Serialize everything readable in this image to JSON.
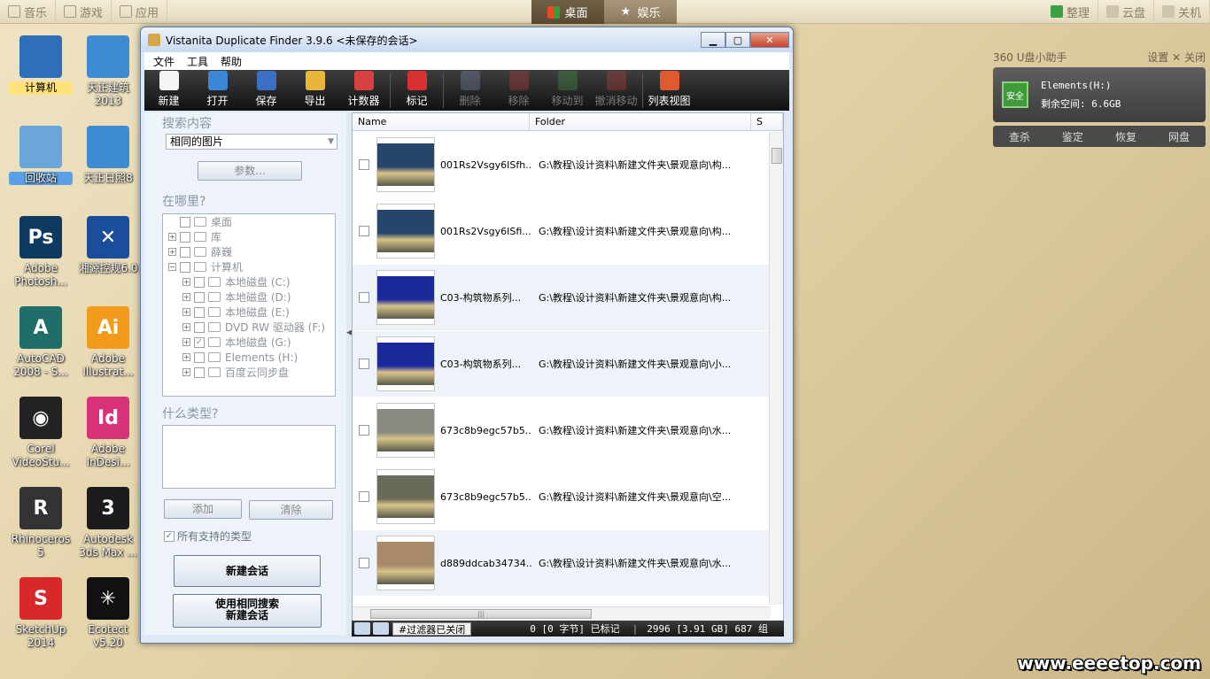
{
  "topbar": {
    "left_items": [
      {
        "icon": "music-note-icon",
        "label": "音乐"
      },
      {
        "icon": "gamepad-icon",
        "label": "游戏"
      },
      {
        "icon": "cube-icon",
        "label": "应用"
      }
    ],
    "center_tabs": [
      {
        "icon": "windows-logo-icon",
        "label": "桌面",
        "active": true
      },
      {
        "icon": "star-icon",
        "label": "娱乐",
        "active": false
      }
    ],
    "right_items": [
      {
        "icon": "organize-icon",
        "label": "整理"
      },
      {
        "icon": "cloud-icon",
        "label": "云盘"
      },
      {
        "icon": "power-icon",
        "label": "关机"
      }
    ]
  },
  "desktop": {
    "icons": [
      {
        "label": "计算机",
        "color": "#2f6fb8"
      },
      {
        "label": "天正建筑\n2013",
        "color": "#3f8bd1"
      },
      {
        "label": "回收站",
        "color": "#6aa6d8"
      },
      {
        "label": "天正日照8",
        "color": "#3f8bd1"
      },
      {
        "label": "Adobe\nPhotosh...",
        "color": "#0d3a5e",
        "glyph": "Ps"
      },
      {
        "label": "湘源控规6.0",
        "color": "#1a4e9a",
        "glyph": "✕"
      },
      {
        "label": "AutoCAD\n2008 - S...",
        "color": "#1f6e6a",
        "glyph": "A"
      },
      {
        "label": "Adobe\nIllustrat...",
        "color": "#f29a1a",
        "glyph": "Ai"
      },
      {
        "label": "Corel\nVideoStu...",
        "color": "#222222",
        "glyph": "◉"
      },
      {
        "label": "Adobe\nInDesi...",
        "color": "#d8327a",
        "glyph": "Id"
      },
      {
        "label": "Rhinoceros\n5",
        "color": "#333333",
        "glyph": "R"
      },
      {
        "label": "Autodesk\n3ds Max ...",
        "color": "#1c1c1c",
        "glyph": "3"
      },
      {
        "label": "SketchUp\n2014",
        "color": "#d8282a",
        "glyph": "S"
      },
      {
        "label": "Ecotect\nv5.20",
        "color": "#111111",
        "glyph": "✳"
      }
    ]
  },
  "uhelper": {
    "title": "360 U盘小助手",
    "settings_label": "设置",
    "close_label": "关闭",
    "badge": "安全",
    "drive_name": "Elements(H:)",
    "free_space": "剩余空间: 6.6GB",
    "buttons": [
      "查杀",
      "鉴定",
      "恢复",
      "网盘"
    ]
  },
  "watermark": "www.eeeetop.com",
  "window": {
    "title": "Vistanita Duplicate Finder 3.9.6 <未保存的会话>",
    "menu": [
      "文件",
      "工具",
      "帮助"
    ],
    "toolbar": [
      {
        "label": "新建",
        "icon": "new-icon",
        "color": "#f4f4f4",
        "disabled": false
      },
      {
        "label": "打开",
        "icon": "open-folder-icon",
        "color": "#3c86d8",
        "disabled": false
      },
      {
        "label": "保存",
        "icon": "save-icon",
        "color": "#3b6fc4",
        "disabled": false
      },
      {
        "label": "导出",
        "icon": "export-icon",
        "color": "#e7b63a",
        "disabled": false
      },
      {
        "label": "计数器",
        "icon": "counter-icon",
        "color": "#d94040",
        "disabled": false
      },
      {
        "label": "标记",
        "icon": "check-mark-icon",
        "color": "#d93030",
        "disabled": false
      },
      {
        "label": "删除",
        "icon": "delete-icon",
        "color": "#7a8fb0",
        "disabled": true
      },
      {
        "label": "移除",
        "icon": "remove-icon",
        "color": "#c04040",
        "disabled": true
      },
      {
        "label": "移动到",
        "icon": "move-to-icon",
        "color": "#4a9a4a",
        "disabled": true
      },
      {
        "label": "撤消移动",
        "icon": "undo-move-icon",
        "color": "#c04040",
        "disabled": true
      },
      {
        "label": "列表视图",
        "icon": "list-view-icon",
        "color": "#e05a30",
        "disabled": false
      }
    ],
    "left": {
      "search_title": "搜索内容",
      "search_value": "相同的图片",
      "params_button": "参数...",
      "where_title": "在哪里?",
      "tree": [
        {
          "label": "桌面",
          "indent": 0,
          "expander": "",
          "checked": false
        },
        {
          "label": "库",
          "indent": 0,
          "expander": "+",
          "checked": false
        },
        {
          "label": "薛巍",
          "indent": 0,
          "expander": "+",
          "checked": false
        },
        {
          "label": "计算机",
          "indent": 0,
          "expander": "-",
          "checked": false
        },
        {
          "label": "本地磁盘 (C:)",
          "indent": 1,
          "expander": "+",
          "checked": false
        },
        {
          "label": "本地磁盘 (D:)",
          "indent": 1,
          "expander": "+",
          "checked": false
        },
        {
          "label": "本地磁盘 (E:)",
          "indent": 1,
          "expander": "+",
          "checked": false
        },
        {
          "label": "DVD RW 驱动器 (F:)",
          "indent": 1,
          "expander": "+",
          "checked": false
        },
        {
          "label": "本地磁盘 (G:)",
          "indent": 1,
          "expander": "+",
          "checked": true
        },
        {
          "label": "Elements (H:)",
          "indent": 1,
          "expander": "+",
          "checked": false
        },
        {
          "label": "百度云同步盘",
          "indent": 1,
          "expander": "+",
          "checked": false
        }
      ],
      "type_title": "什么类型?",
      "add_button": "添加",
      "clear_button": "清除",
      "all_types_label": "所有支持的类型",
      "new_session_button": "新建会话",
      "same_search_line1": "使用相同搜索",
      "same_search_line2": "新建会话"
    },
    "results": {
      "columns": [
        "Name",
        "Folder",
        "S"
      ],
      "rows": [
        {
          "name": "001Rs2Vsgy6ISfh...",
          "folder": "G:\\教程\\设计资料\\新建文件夹\\景观意向\\构...",
          "thumb": "#27446a"
        },
        {
          "name": "001Rs2Vsgy6ISfi...",
          "folder": "G:\\教程\\设计资料\\新建文件夹\\景观意向\\构...",
          "thumb": "#27446a"
        },
        {
          "name": "C03-构筑物系列...",
          "folder": "G:\\教程\\设计资料\\新建文件夹\\景观意向\\构...",
          "thumb": "#1b2a9a"
        },
        {
          "name": "C03-构筑物系列...",
          "folder": "G:\\教程\\设计资料\\新建文件夹\\景观意向\\小...",
          "thumb": "#1b2a9a"
        },
        {
          "name": "673c8b9egc57b5...",
          "folder": "G:\\教程\\设计资料\\新建文件夹\\景观意向\\水...",
          "thumb": "#8a8a82"
        },
        {
          "name": "673c8b9egc57b5...",
          "folder": "G:\\教程\\设计资料\\新建文件夹\\景观意向\\空...",
          "thumb": "#6a6a58"
        },
        {
          "name": "d889ddcab34734...",
          "folder": "G:\\教程\\设计资料\\新建文件夹\\景观意向\\水...",
          "thumb": "#a88a68"
        }
      ]
    },
    "status": {
      "filter_label": "#过滤器已关闭",
      "marked": "0 [0 字节] 已标记",
      "total": "2996 [3.91 GB] 687 组"
    }
  }
}
